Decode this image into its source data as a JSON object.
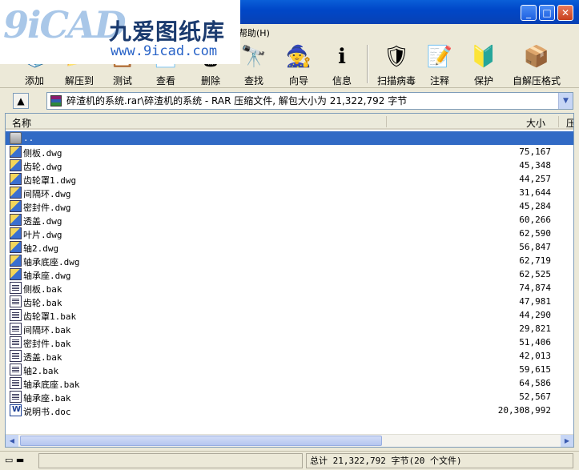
{
  "watermark": {
    "mark": "9iCAD",
    "name": "九爱图纸库",
    "url": "www.9icad.com"
  },
  "window": {
    "min": "_",
    "max": "□",
    "close": "✕"
  },
  "menu": {
    "help": "帮助(H)"
  },
  "toolbar": {
    "buttons": [
      {
        "label": "添加",
        "icon": "📚"
      },
      {
        "label": "解压到",
        "icon": "📂"
      },
      {
        "label": "测试",
        "icon": "📋"
      },
      {
        "label": "查看",
        "icon": "📄"
      },
      {
        "label": "删除",
        "icon": "🗑"
      },
      {
        "label": "查找",
        "icon": "🔭"
      },
      {
        "label": "向导",
        "icon": "🧙"
      },
      {
        "label": "信息",
        "icon": "ℹ"
      },
      {
        "label": "扫描病毒",
        "icon": "🛡"
      },
      {
        "label": "注释",
        "icon": "📝"
      },
      {
        "label": "保护",
        "icon": "🔰"
      },
      {
        "label": "自解压格式",
        "icon": "📦"
      }
    ]
  },
  "address": {
    "path": "碎渣机的系统.rar\\碎渣机的系统 - RAR 压缩文件, 解包大小为 21,322,792 字节"
  },
  "columns": {
    "name": "名称",
    "size": "大小",
    "packed": "压"
  },
  "files": [
    {
      "name": "..",
      "size": "",
      "type": "folder"
    },
    {
      "name": "侧板.dwg",
      "size": "75,167",
      "type": "dwg"
    },
    {
      "name": "齿轮.dwg",
      "size": "45,348",
      "type": "dwg"
    },
    {
      "name": "齿轮罩1.dwg",
      "size": "44,257",
      "type": "dwg"
    },
    {
      "name": "间隔环.dwg",
      "size": "31,644",
      "type": "dwg"
    },
    {
      "name": "密封件.dwg",
      "size": "45,284",
      "type": "dwg"
    },
    {
      "name": "透盖.dwg",
      "size": "60,266",
      "type": "dwg"
    },
    {
      "name": "叶片.dwg",
      "size": "62,590",
      "type": "dwg"
    },
    {
      "name": "轴2.dwg",
      "size": "56,847",
      "type": "dwg"
    },
    {
      "name": "轴承底座.dwg",
      "size": "62,719",
      "type": "dwg"
    },
    {
      "name": "轴承座.dwg",
      "size": "62,525",
      "type": "dwg"
    },
    {
      "name": "侧板.bak",
      "size": "74,874",
      "type": "bak"
    },
    {
      "name": "齿轮.bak",
      "size": "47,981",
      "type": "bak"
    },
    {
      "name": "齿轮罩1.bak",
      "size": "44,290",
      "type": "bak"
    },
    {
      "name": "间隔环.bak",
      "size": "29,821",
      "type": "bak"
    },
    {
      "name": "密封件.bak",
      "size": "51,406",
      "type": "bak"
    },
    {
      "name": "透盖.bak",
      "size": "42,013",
      "type": "bak"
    },
    {
      "name": "轴2.bak",
      "size": "59,615",
      "type": "bak"
    },
    {
      "name": "轴承底座.bak",
      "size": "64,586",
      "type": "bak"
    },
    {
      "name": "轴承座.bak",
      "size": "52,567",
      "type": "bak"
    },
    {
      "name": "说明书.doc",
      "size": "20,308,992",
      "type": "doc"
    }
  ],
  "status": {
    "total": "总计 21,322,792 字节(20 个文件)"
  }
}
